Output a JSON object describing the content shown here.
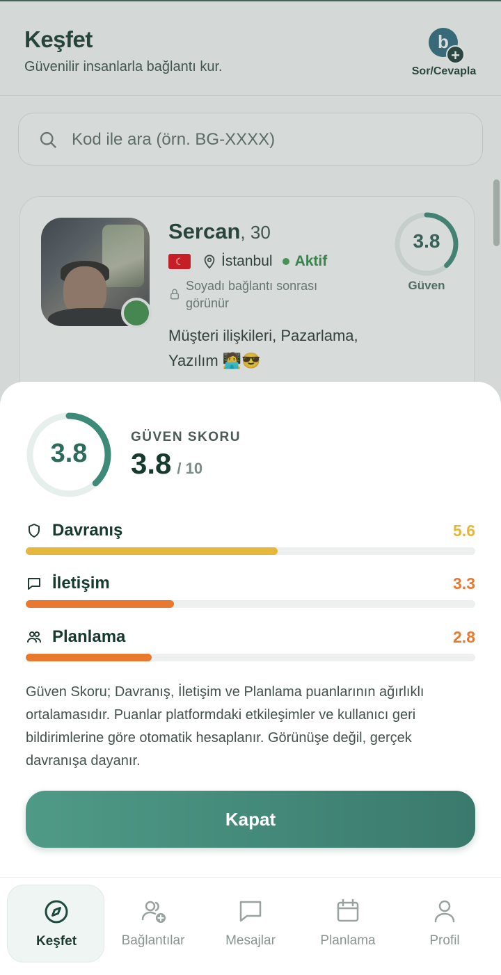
{
  "header": {
    "title": "Keşfet",
    "subtitle": "Güvenilir insanlarla bağlantı kur.",
    "ask_label": "Sor/Cevapla",
    "ask_logo": "b"
  },
  "search": {
    "placeholder": "Kod ile ara (örn. BG-XXXX)",
    "icon": "search-icon"
  },
  "profile_card": {
    "name": "Sercan",
    "age": ", 30",
    "country_flag": "Türkiye",
    "city": "İstanbul",
    "status": "Aktif",
    "surname_note": "Soyadı bağlantı sonrası görünür",
    "tags": "Müşteri ilişkileri, Pazarlama, Yazılım 🧑‍💻😎",
    "trust_value": "3.8",
    "trust_score": 3.8,
    "trust_label": "Güven"
  },
  "sheet": {
    "score_label": "GÜVEN SKORU",
    "score_value": "3.8",
    "score_value_num": 3.8,
    "score_max": "/ 10",
    "metrics": [
      {
        "name": "Davranış",
        "value": "5.6",
        "value_num": 5.6,
        "max": 10,
        "color": "#e5b73b",
        "icon": "shield-icon"
      },
      {
        "name": "İletişim",
        "value": "3.3",
        "value_num": 3.3,
        "max": 10,
        "color": "#e8792e",
        "icon": "chat-icon"
      },
      {
        "name": "Planlama",
        "value": "2.8",
        "value_num": 2.8,
        "max": 10,
        "color": "#e8792e",
        "icon": "users-icon"
      }
    ],
    "description": "Güven Skoru; Davranış, İletişim ve Planlama puanlarının ağırlıklı ortalamasıdır. Puanlar platformdaki etkileşimler ve kullanıcı geri bildirimlerine göre otomatik hesaplanır. Görünüşe değil, gerçek davranışa dayanır.",
    "close_label": "Kapat"
  },
  "nav": {
    "items": [
      {
        "label": "Keşfet",
        "icon": "compass-icon",
        "active": true
      },
      {
        "label": "Bağlantılar",
        "icon": "users-add-icon",
        "active": false
      },
      {
        "label": "Mesajlar",
        "icon": "message-icon",
        "active": false
      },
      {
        "label": "Planlama",
        "icon": "calendar-icon",
        "active": false
      },
      {
        "label": "Profil",
        "icon": "user-icon",
        "active": false
      }
    ]
  },
  "colors": {
    "brand": "#3d8a78",
    "dark_text": "#173a2e",
    "ring_track": "#e7efec"
  }
}
